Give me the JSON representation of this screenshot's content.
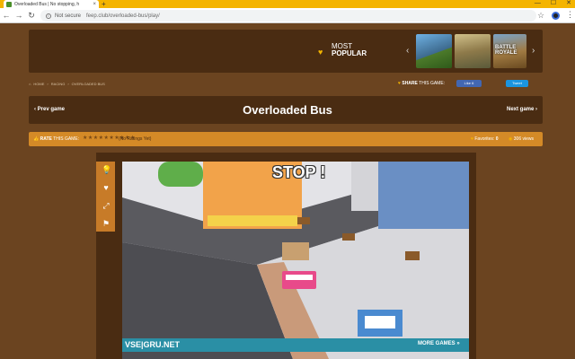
{
  "browser": {
    "tab_title": "Overloaded Bus | No stopping, h",
    "tab_close": "×",
    "new_tab": "+",
    "win_min": "—",
    "win_max": "☐",
    "win_close": "✕",
    "back": "←",
    "forward": "→",
    "reload": "↻",
    "not_secure": "Not secure",
    "url": "feep.club/overloaded-bus/play/",
    "star": "☆",
    "menu": "⋮"
  },
  "banner": {
    "most": "MOST",
    "popular": "POPULAR",
    "prev_arrow": "‹",
    "next_arrow": "›",
    "thumbs": [
      "",
      "",
      "BATTLE ROYALE"
    ]
  },
  "breadcrumb": {
    "home": "HOME",
    "sep": "›",
    "racing": "RACING",
    "current": "OVERLOADED BUS"
  },
  "share": {
    "label_bold": "SHARE",
    "label_rest": " THIS GAME:",
    "like": "Like 6",
    "tweet": "Tweet"
  },
  "title_bar": {
    "prev": "‹  Prev game",
    "title": "Overloaded Bus",
    "next": "Next game  ›"
  },
  "rating": {
    "rate_bold": "RATE",
    "rate_rest": " THIS GAME:",
    "stars": "★★★★★★★★★★",
    "no_ratings": "(No Ratings Yet)",
    "favorites_label": "Favorites:",
    "favorites_count": "0",
    "views": "306 views"
  },
  "game": {
    "stop_text": "STOP !",
    "vsegru_logo": "VSE|GRU.NET",
    "more_games": "MORE GAMES »"
  },
  "colors": {
    "brown_dark": "#4a2c12",
    "orange": "#d48a27",
    "gold": "#f2b400"
  }
}
